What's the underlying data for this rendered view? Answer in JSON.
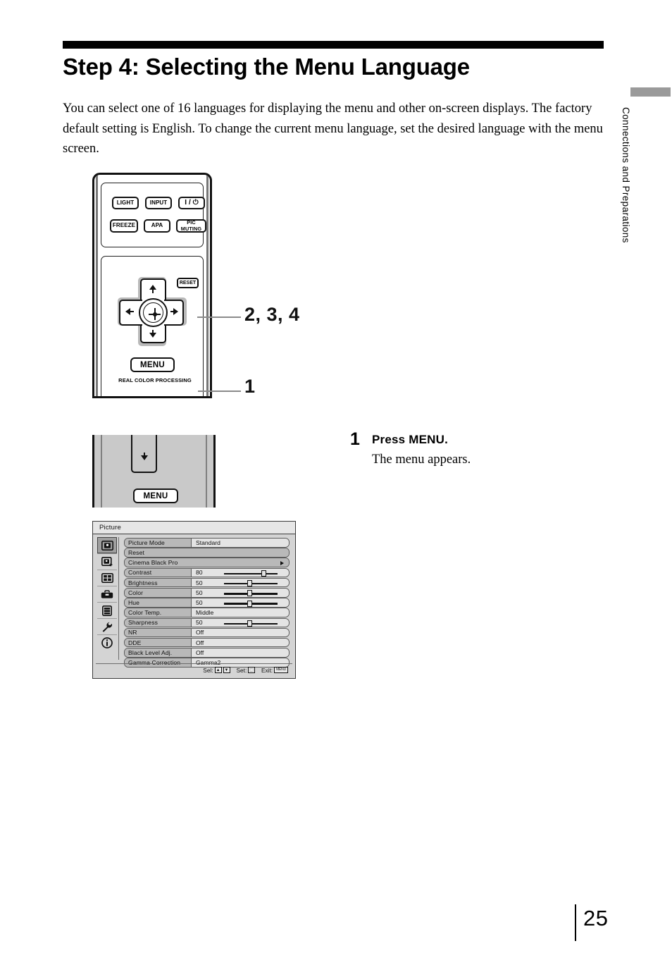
{
  "page": {
    "title": "Step 4: Selecting the Menu Language",
    "intro": "You can select one of 16 languages for displaying the menu and other on-screen displays. The factory default setting is English. To change the current menu language, set the desired language with the menu screen.",
    "number": "25",
    "side_tab_text": "Connections and Preparations"
  },
  "remote": {
    "buttons": {
      "light": "LIGHT",
      "input": "INPUT",
      "power": "I / ⏻",
      "freeze": "FREEZE",
      "apa": "APA",
      "pic_muting": "PIC\nMUTING",
      "reset": "RESET",
      "menu": "MENU"
    },
    "rcp_label": "REAL COLOR PROCESSING",
    "callouts": {
      "dpad": "2, 3, 4",
      "menu": "1"
    }
  },
  "closeup": {
    "menu_label": "MENU"
  },
  "step": {
    "number": "1",
    "heading": "Press MENU.",
    "body": "The menu appears."
  },
  "osd": {
    "title": "Picture",
    "sidebar_icons": [
      "picture-icon",
      "picture-add-icon",
      "screen-icon",
      "toolbox-icon",
      "list-icon",
      "wrench-icon",
      "info-icon"
    ],
    "selected_icon_index": 0,
    "rows": [
      {
        "label": "Picture Mode",
        "value": "Standard",
        "kind": "value"
      },
      {
        "label": "Reset",
        "value": "",
        "kind": "plain"
      },
      {
        "label": "Cinema Black Pro",
        "value": "",
        "kind": "submenu"
      },
      {
        "label": "Contrast",
        "value": "80",
        "kind": "slider",
        "percent": 80
      },
      {
        "label": "Brightness",
        "value": "50",
        "kind": "slider",
        "percent": 50
      },
      {
        "label": "Color",
        "value": "50",
        "kind": "slider",
        "percent": 50
      },
      {
        "label": "Hue",
        "value": "50",
        "kind": "slider",
        "percent": 50
      },
      {
        "label": "Color Temp.",
        "value": "Middle",
        "kind": "value"
      },
      {
        "label": "Sharpness",
        "value": "50",
        "kind": "slider",
        "percent": 50
      },
      {
        "label": "NR",
        "value": "Off",
        "kind": "value"
      },
      {
        "label": "DDE",
        "value": "Off",
        "kind": "value"
      },
      {
        "label": "Black Level Adj.",
        "value": "Off",
        "kind": "value"
      },
      {
        "label": "Gamma Correction",
        "value": "Gamma2",
        "kind": "value"
      }
    ],
    "footer": {
      "sel_label": "Sel:",
      "sel_keys": [
        "▲",
        "▼"
      ],
      "set_label": "Set:",
      "set_key": "⬚",
      "exit_label": "Exit:",
      "exit_key": "MENU"
    }
  }
}
